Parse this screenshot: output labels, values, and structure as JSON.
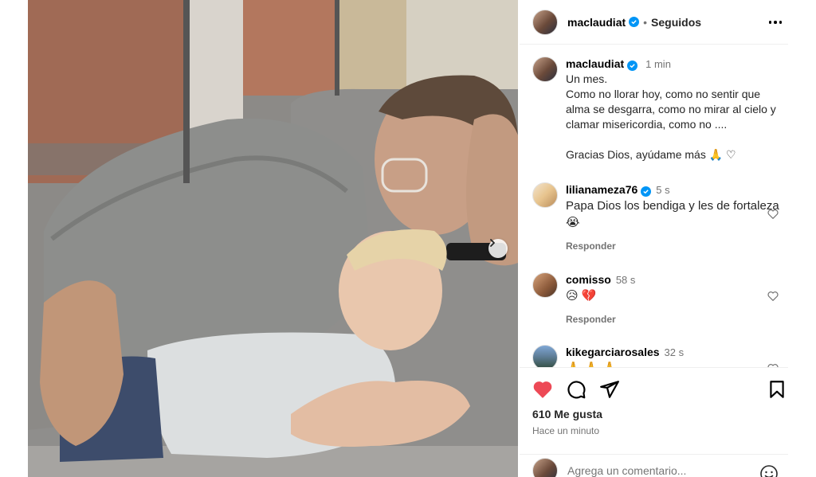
{
  "post": {
    "author": "maclaudiat",
    "follow_dot": "•",
    "follow_status": "Seguidos",
    "more_icon": "more-horizontal-icon"
  },
  "caption": {
    "author": "maclaudiat",
    "time": "1 min",
    "text": "Un mes.\nComo no llorar hoy, como no sentir que alma se desgarra, como no mirar al cielo y clamar misericordia, como no ....\n\nGracias Dios, ayúdame más 🙏 ♡"
  },
  "comments": [
    {
      "author": "lilianameza76",
      "verified": true,
      "time": "5 s",
      "text": "Papa Dios los bendiga y les de fortaleza 😭",
      "reply": "Responder"
    },
    {
      "author": "comisso",
      "verified": false,
      "time": "58 s",
      "text": "😥 💔",
      "reply": "Responder"
    },
    {
      "author": "kikegarciarosales",
      "verified": false,
      "time": "32 s",
      "text": "🙏 🙏 🙏",
      "reply": ""
    }
  ],
  "stats": {
    "likes": "610 Me gusta",
    "time_ago": "Hace un minuto"
  },
  "composer": {
    "placeholder": "Agrega un comentario..."
  },
  "colors": {
    "verified": "#0095f6",
    "like_red": "#ed4956",
    "secondary_text": "#737373"
  }
}
